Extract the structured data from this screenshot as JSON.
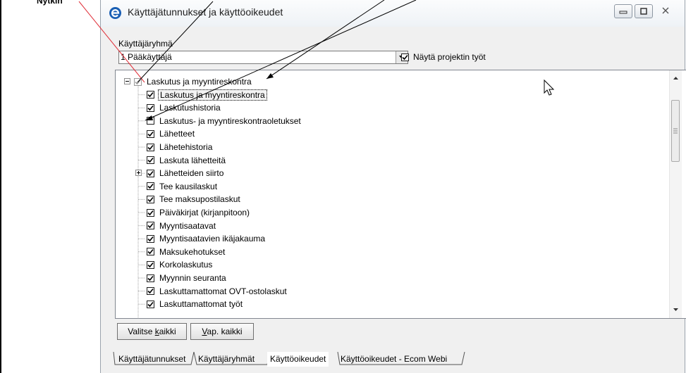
{
  "corner_label": "Nytkin",
  "window": {
    "title": "Käyttäjätunnukset ja käyttöoikeudet"
  },
  "group": {
    "label": "Käyttäjäryhmä",
    "selected": "1 Pääkäyttäjä",
    "show_project_label": "Näytä projektin työt",
    "show_project_checked": true
  },
  "tree": {
    "root": {
      "label": "Laskutus ja myyntireskontra",
      "checked": true
    },
    "items": [
      {
        "label": "Laskutus ja myyntireskontra",
        "checked": true,
        "selected": true
      },
      {
        "label": "Laskutushistoria",
        "checked": true
      },
      {
        "label": "Laskutus- ja myyntireskontraoletukset",
        "checked": false
      },
      {
        "label": "Lähetteet",
        "checked": true
      },
      {
        "label": "Lähetehistoria",
        "checked": true
      },
      {
        "label": "Laskuta lähetteitä",
        "checked": true
      },
      {
        "label": "Lähetteiden siirto",
        "checked": true,
        "expandable": true
      },
      {
        "label": "Tee kausilaskut",
        "checked": true
      },
      {
        "label": "Tee maksupostilaskut",
        "checked": true
      },
      {
        "label": "Päiväkirjat (kirjanpitoon)",
        "checked": true
      },
      {
        "label": "Myyntisaatavat",
        "checked": true
      },
      {
        "label": "Myyntisaatavien ikäjakauma",
        "checked": true
      },
      {
        "label": "Maksukehotukset",
        "checked": true
      },
      {
        "label": "Korkolaskutus",
        "checked": true
      },
      {
        "label": "Myynnin seuranta",
        "checked": true
      },
      {
        "label": "Laskuttamattomat OVT-ostolaskut",
        "checked": true
      },
      {
        "label": "Laskuttamattomat työt",
        "checked": true
      }
    ]
  },
  "buttons": {
    "select_all": "Valitse kaikki",
    "clear_all": "Vap. kaikki"
  },
  "tabs": [
    {
      "label": "Käyttäjätunnukset"
    },
    {
      "label": "Käyttäjäryhmät"
    },
    {
      "label": "Käyttöoikeudet",
      "active": true
    },
    {
      "label": "Käyttöoikeudet - Ecom Webi"
    }
  ]
}
